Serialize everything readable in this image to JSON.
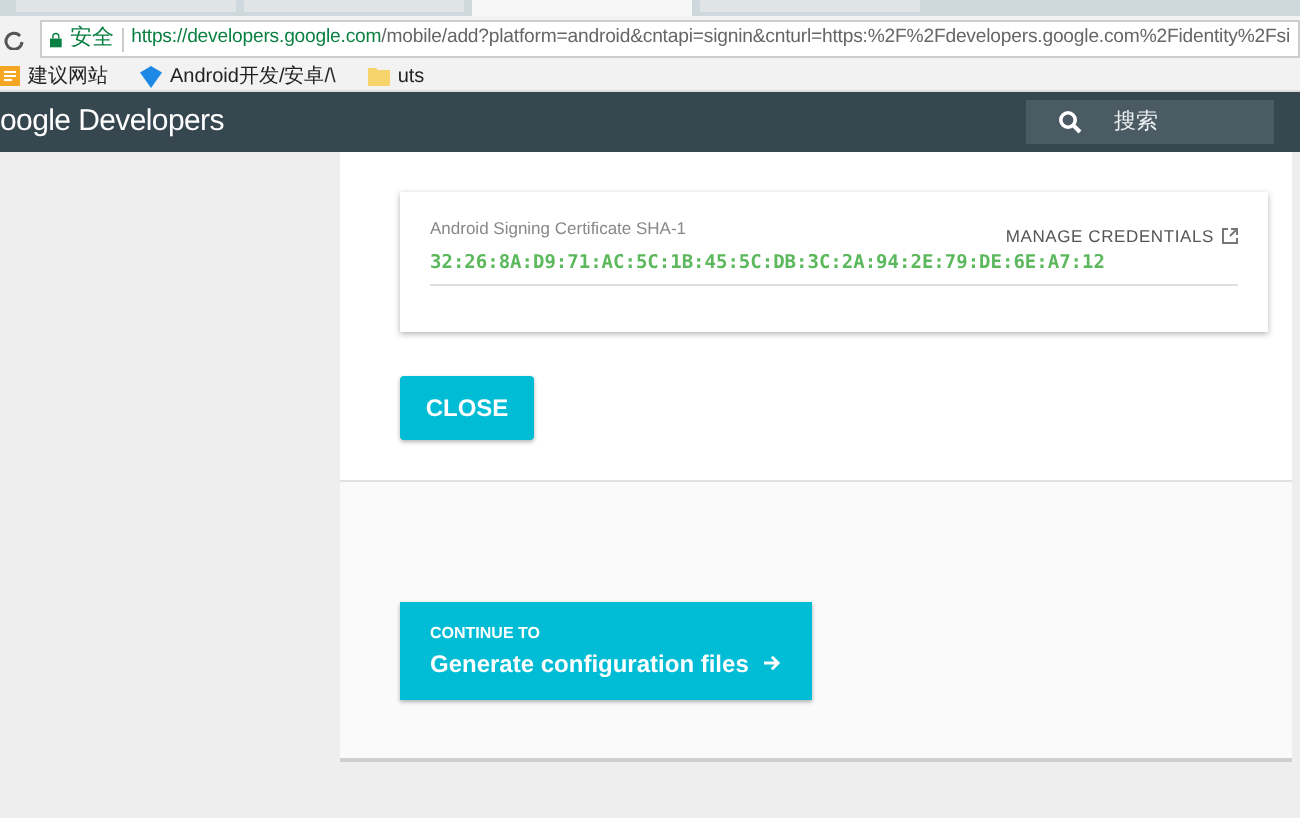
{
  "browser": {
    "tabs": [
      {
        "selected": false
      },
      {
        "selected": false
      },
      {
        "selected": true
      },
      {
        "selected": false
      }
    ],
    "security_label": "安全",
    "url_host": "https://developers.google.com",
    "url_path": "/mobile/add?platform=android&cntapi=signin&cnturl=https:%2F%2Fdevelopers.google.com%2Fidentity%2Fsi",
    "bookmarks": [
      {
        "kind": "apps",
        "label": "建议网站"
      },
      {
        "kind": "site",
        "label": "Android开发/安卓/\\"
      },
      {
        "kind": "folder",
        "label": "uts"
      }
    ]
  },
  "header": {
    "logo": "oogle Developers",
    "search_placeholder": "搜索"
  },
  "card": {
    "label": "Android Signing Certificate SHA-1",
    "link": "MANAGE CREDENTIALS",
    "value": "32:26:8A:D9:71:AC:5C:1B:45:5C:DB:3C:2A:94:2E:79:DE:6E:A7:12"
  },
  "close_button": "CLOSE",
  "continue": {
    "overline": "CONTINUE TO",
    "label": "Generate configuration files"
  }
}
